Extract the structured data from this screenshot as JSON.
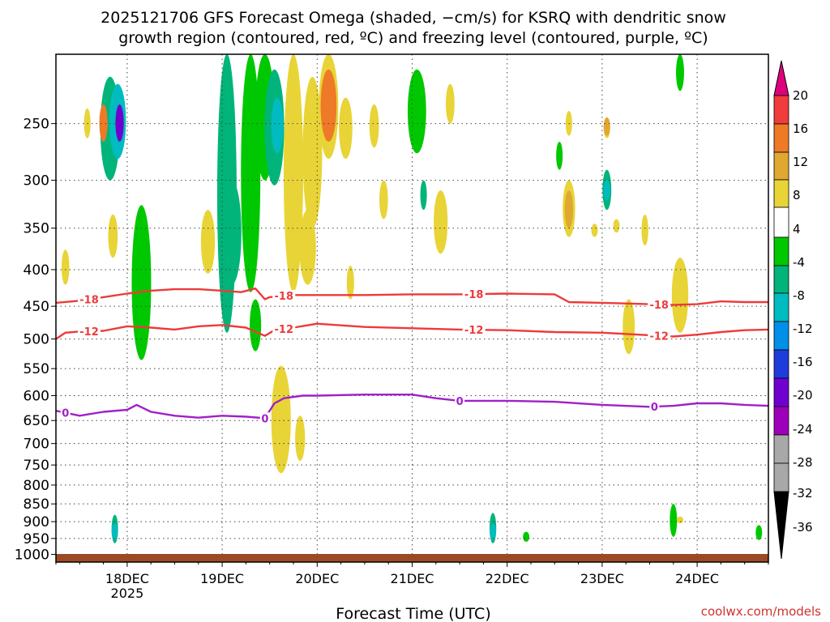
{
  "chart_data": {
    "type": "heatmap",
    "title_line1": "2025121706 GFS Forecast Omega (shaded, −cm/s) for KSRQ with dendritic snow",
    "title_line2": "growth region (contoured, red, ºC) and freezing level (contoured, purple, ºC)",
    "xlabel": "Forecast Time (UTC)",
    "credit": "coolwx.com/models",
    "y_scale": "log-pressure",
    "y_ticks": [
      250,
      300,
      350,
      400,
      450,
      500,
      550,
      600,
      650,
      700,
      750,
      800,
      850,
      900,
      950,
      1000
    ],
    "ylim": [
      200,
      1025
    ],
    "x_ticks": [
      {
        "day": 18,
        "label": "18DEC",
        "sub": "2025"
      },
      {
        "day": 19,
        "label": "19DEC"
      },
      {
        "day": 20,
        "label": "20DEC"
      },
      {
        "day": 21,
        "label": "21DEC"
      },
      {
        "day": 22,
        "label": "22DEC"
      },
      {
        "day": 23,
        "label": "23DEC"
      },
      {
        "day": 24,
        "label": "24DEC"
      }
    ],
    "xlim": [
      17.25,
      24.75
    ],
    "grid": true,
    "colorbar": {
      "labels": [
        "20",
        "16",
        "12",
        "8",
        "4",
        "-4",
        "-8",
        "-12",
        "-16",
        "-20",
        "-24",
        "-28",
        "-32",
        "-36"
      ],
      "top_arrow_color": "#e0007e",
      "bottom_arrow_color": "#000000",
      "colors": [
        "#e0007e",
        "#f03c3c",
        "#ee7a28",
        "#e0a830",
        "#e8d436",
        "#ffffff",
        "#00c800",
        "#00b47a",
        "#00bcc0",
        "#0090e8",
        "#1e3cdc",
        "#7000d0",
        "#9c00b8",
        "#a8a8a8"
      ]
    },
    "surface_color": "#9c4a24",
    "contours": [
      {
        "label": "-18",
        "color": "#ee3a3a",
        "x": [
          17.25,
          17.5,
          17.75,
          18.0,
          18.25,
          18.5,
          18.75,
          19.0,
          19.2,
          19.35,
          19.45,
          19.5,
          19.7,
          20.0,
          20.5,
          21.0,
          21.5,
          22.0,
          22.5,
          22.65,
          23.0,
          23.5,
          23.75,
          24.0,
          24.25,
          24.5,
          24.75
        ],
        "p": [
          445,
          442,
          437,
          432,
          428,
          426,
          426,
          428,
          430,
          425,
          440,
          437,
          434,
          434,
          434,
          433,
          433,
          432,
          433,
          444,
          445,
          447,
          448,
          447,
          443,
          444,
          444
        ]
      },
      {
        "label": "-12",
        "color": "#ee3a3a",
        "x": [
          17.25,
          17.35,
          17.5,
          17.75,
          18.0,
          18.25,
          18.5,
          18.75,
          19.0,
          19.25,
          19.45,
          19.55,
          19.75,
          20.0,
          20.5,
          21.0,
          21.5,
          22.0,
          22.5,
          23.0,
          23.5,
          23.75,
          24.0,
          24.25,
          24.5,
          24.75
        ],
        "p": [
          500,
          490,
          488,
          487,
          480,
          482,
          485,
          480,
          478,
          482,
          495,
          486,
          482,
          476,
          481,
          483,
          485,
          486,
          489,
          490,
          494,
          496,
          493,
          489,
          486,
          485
        ]
      },
      {
        "label": "0",
        "color": "#a020c8",
        "x": [
          17.25,
          17.5,
          17.75,
          18.0,
          18.1,
          18.25,
          18.5,
          18.75,
          19.0,
          19.25,
          19.45,
          19.55,
          19.65,
          19.85,
          20.0,
          20.5,
          21.0,
          21.25,
          21.5,
          22.0,
          22.5,
          23.0,
          23.5,
          23.75,
          24.0,
          24.25,
          24.5,
          24.75
        ],
        "p": [
          630,
          640,
          632,
          628,
          618,
          632,
          640,
          644,
          640,
          642,
          645,
          615,
          605,
          600,
          600,
          598,
          598,
          605,
          610,
          610,
          612,
          618,
          622,
          620,
          615,
          615,
          618,
          620
        ]
      }
    ],
    "omega_cells": [
      {
        "t": 17.35,
        "p": [
          375,
          420
        ],
        "v": 6
      },
      {
        "t": 17.58,
        "p": [
          238,
          262
        ],
        "v": 6
      },
      {
        "t": 17.82,
        "p": [
          215,
          300
        ],
        "v": -8
      },
      {
        "t": 17.9,
        "p": [
          220,
          280
        ],
        "v": -12
      },
      {
        "t": 17.92,
        "p": [
          235,
          265
        ],
        "v": -24
      },
      {
        "t": 17.75,
        "p": [
          235,
          265
        ],
        "v": 12
      },
      {
        "t": 17.85,
        "p": [
          335,
          385
        ],
        "v": 6
      },
      {
        "t": 18.15,
        "p": [
          325,
          535
        ],
        "v": -6
      },
      {
        "t": 17.87,
        "p": [
          880,
          965
        ],
        "v": -8
      },
      {
        "t": 17.87,
        "p": [
          905,
          955
        ],
        "v": -12
      },
      {
        "t": 18.85,
        "p": [
          330,
          405
        ],
        "v": 6
      },
      {
        "t": 19.05,
        "p": [
          200,
          490
        ],
        "v": -8
      },
      {
        "t": 19.1,
        "p": [
          300,
          420
        ],
        "v": -8
      },
      {
        "t": 19.3,
        "p": [
          200,
          430
        ],
        "v": -6
      },
      {
        "t": 19.45,
        "p": [
          200,
          300
        ],
        "v": -6
      },
      {
        "t": 19.55,
        "p": [
          210,
          305
        ],
        "v": -8
      },
      {
        "t": 19.58,
        "p": [
          230,
          275
        ],
        "v": -14
      },
      {
        "t": 19.35,
        "p": [
          440,
          520
        ],
        "v": -6
      },
      {
        "t": 19.75,
        "p": [
          200,
          430
        ],
        "v": 6
      },
      {
        "t": 19.95,
        "p": [
          215,
          350
        ],
        "v": 6
      },
      {
        "t": 20.12,
        "p": [
          200,
          280
        ],
        "v": 6
      },
      {
        "t": 20.12,
        "p": [
          210,
          265
        ],
        "v": 12
      },
      {
        "t": 19.9,
        "p": [
          330,
          420
        ],
        "v": 6
      },
      {
        "t": 20.3,
        "p": [
          230,
          280
        ],
        "v": 6
      },
      {
        "t": 20.35,
        "p": [
          395,
          440
        ],
        "v": 6
      },
      {
        "t": 19.62,
        "p": [
          545,
          770
        ],
        "v": 6
      },
      {
        "t": 19.82,
        "p": [
          640,
          740
        ],
        "v": 6
      },
      {
        "t": 20.6,
        "p": [
          235,
          270
        ],
        "v": 6
      },
      {
        "t": 20.7,
        "p": [
          300,
          340
        ],
        "v": 6
      },
      {
        "t": 21.05,
        "p": [
          210,
          275
        ],
        "v": -6
      },
      {
        "t": 21.3,
        "p": [
          310,
          380
        ],
        "v": 6
      },
      {
        "t": 21.4,
        "p": [
          220,
          250
        ],
        "v": 6
      },
      {
        "t": 21.12,
        "p": [
          300,
          330
        ],
        "v": -8
      },
      {
        "t": 21.85,
        "p": [
          875,
          965
        ],
        "v": -8
      },
      {
        "t": 21.85,
        "p": [
          905,
          955
        ],
        "v": -12
      },
      {
        "t": 22.2,
        "p": [
          930,
          960
        ],
        "v": -6
      },
      {
        "t": 22.55,
        "p": [
          265,
          290
        ],
        "v": -6
      },
      {
        "t": 22.65,
        "p": [
          240,
          260
        ],
        "v": 6
      },
      {
        "t": 22.65,
        "p": [
          300,
          360
        ],
        "v": 6
      },
      {
        "t": 22.65,
        "p": [
          310,
          350
        ],
        "v": 10
      },
      {
        "t": 23.05,
        "p": [
          245,
          262
        ],
        "v": 6
      },
      {
        "t": 23.05,
        "p": [
          245,
          260
        ],
        "v": 10
      },
      {
        "t": 23.05,
        "p": [
          290,
          330
        ],
        "v": -8
      },
      {
        "t": 23.05,
        "p": [
          300,
          320
        ],
        "v": -12
      },
      {
        "t": 22.92,
        "p": [
          345,
          360
        ],
        "v": 6
      },
      {
        "t": 23.15,
        "p": [
          340,
          355
        ],
        "v": 6
      },
      {
        "t": 23.45,
        "p": [
          335,
          370
        ],
        "v": 6
      },
      {
        "t": 23.28,
        "p": [
          440,
          525
        ],
        "v": 6
      },
      {
        "t": 23.75,
        "p": [
          850,
          945
        ],
        "v": -6
      },
      {
        "t": 23.82,
        "p": [
          885,
          905
        ],
        "v": 6
      },
      {
        "t": 23.82,
        "p": [
          200,
          225
        ],
        "v": -6
      },
      {
        "t": 23.82,
        "p": [
          385,
          490
        ],
        "v": 6
      },
      {
        "t": 24.65,
        "p": [
          910,
          955
        ],
        "v": -6
      }
    ]
  }
}
